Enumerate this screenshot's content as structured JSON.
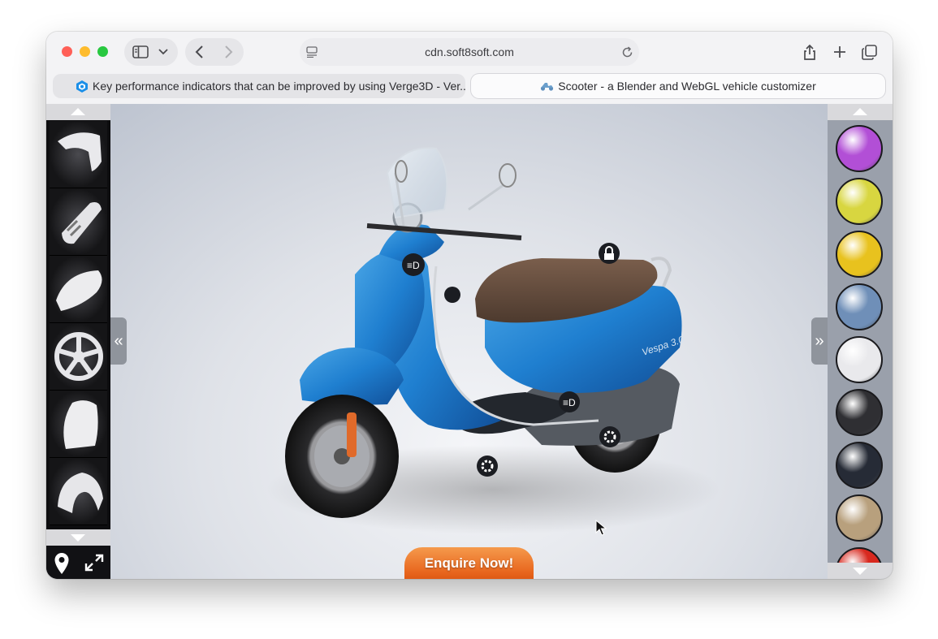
{
  "browser": {
    "address": "cdn.soft8soft.com",
    "tabs": [
      {
        "label": "Key performance indicators that can be improved by using Verge3D - Ver...",
        "active": false
      },
      {
        "label": "Scooter - a Blender and WebGL vehicle customizer",
        "active": true
      }
    ]
  },
  "configurator": {
    "enquire_label": "Enquire Now!",
    "scooter_badge": "Vespa 3.0",
    "left_expand_glyph": "«",
    "right_expand_glyph": "»",
    "parts": [
      {
        "name": "front-fender-part",
        "icon": "fender-icon"
      },
      {
        "name": "rear-light-part",
        "icon": "light-icon"
      },
      {
        "name": "seat-part",
        "icon": "seat-icon"
      },
      {
        "name": "wheel-part",
        "icon": "wheel-icon"
      },
      {
        "name": "leg-shield-part",
        "icon": "shield-icon"
      },
      {
        "name": "headset-part",
        "icon": "headset-icon"
      }
    ],
    "swatches": [
      "#b24fd6",
      "#d8d640",
      "#e8c21e",
      "#6f8fb8",
      "#e9e9ec",
      "#2f2f33",
      "#262b36",
      "#b8a07d",
      "#d8291f"
    ]
  }
}
